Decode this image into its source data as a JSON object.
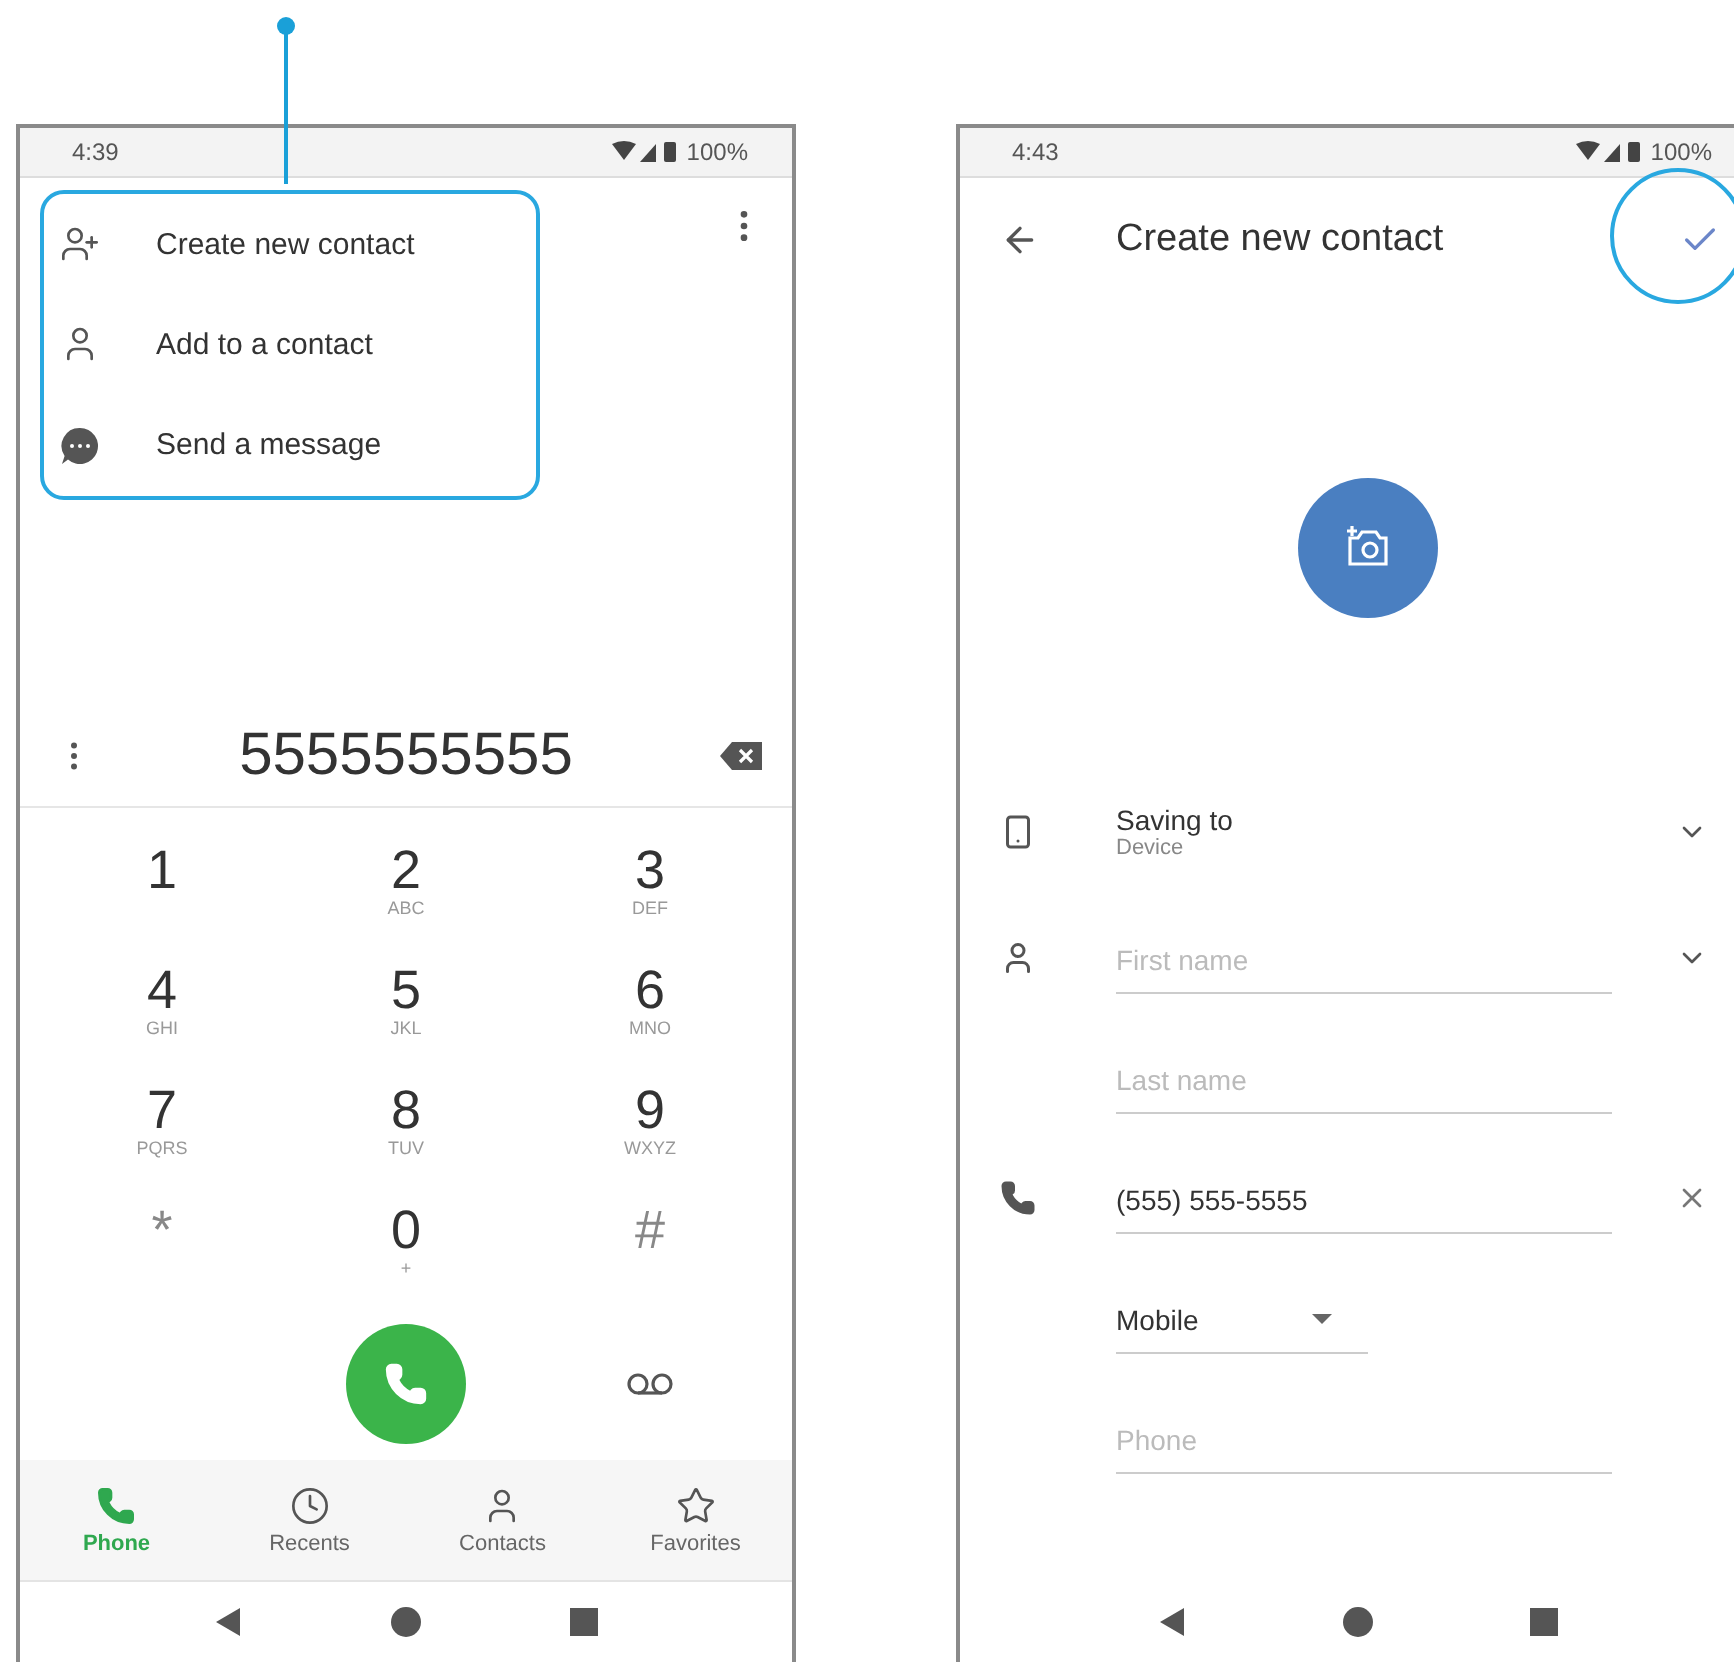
{
  "dialer": {
    "status": {
      "time": "4:39",
      "battery": "100%"
    },
    "menu": [
      {
        "kind": "add-person",
        "label": "Create new contact"
      },
      {
        "kind": "person",
        "label": "Add to a contact"
      },
      {
        "kind": "message",
        "label": "Send a message"
      }
    ],
    "number": "5555555555",
    "keys": [
      {
        "digit": "1"
      },
      {
        "digit": "2",
        "letters": "ABC"
      },
      {
        "digit": "3",
        "letters": "DEF"
      },
      {
        "digit": "4",
        "letters": "GHI"
      },
      {
        "digit": "5",
        "letters": "JKL"
      },
      {
        "digit": "6",
        "letters": "MNO"
      },
      {
        "digit": "7",
        "letters": "PQRS"
      },
      {
        "digit": "8",
        "letters": "TUV"
      },
      {
        "digit": "9",
        "letters": "WXYZ"
      },
      {
        "digit": "*"
      },
      {
        "digit": "0",
        "letters": "+"
      },
      {
        "digit": "#"
      }
    ],
    "tabs": [
      {
        "kind": "phone",
        "label": "Phone",
        "selected": true
      },
      {
        "kind": "clock",
        "label": "Recents",
        "selected": false
      },
      {
        "kind": "person",
        "label": "Contacts",
        "selected": false
      },
      {
        "kind": "star",
        "label": "Favorites",
        "selected": false
      }
    ]
  },
  "editor": {
    "status": {
      "time": "4:43",
      "battery": "100%"
    },
    "title": "Create new contact",
    "saving": {
      "label": "Saving to",
      "value": "Device"
    },
    "fields": [
      {
        "kind": "name",
        "placeholder": "First name"
      },
      {
        "kind": "plain",
        "placeholder": "Last name"
      },
      {
        "kind": "phone",
        "value": "(555) 555-5555"
      },
      {
        "kind": "type",
        "value": "Mobile"
      },
      {
        "kind": "plain",
        "placeholder": "Phone"
      }
    ]
  }
}
